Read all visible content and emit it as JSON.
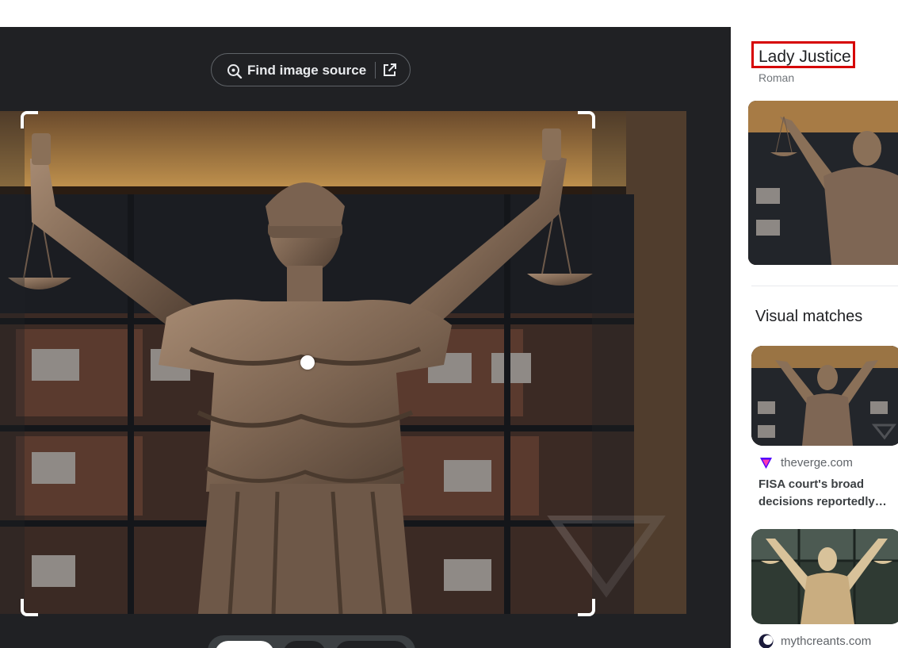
{
  "viewer": {
    "find_source_label": "Find image source",
    "find_source_icon": "lens-search-icon",
    "open_external_icon": "open-in-new-icon"
  },
  "knowledge_panel": {
    "title": "Lady Justice",
    "subtitle": "Roman"
  },
  "visual_matches": {
    "heading": "Visual matches",
    "items": [
      {
        "source": "theverge.com",
        "caption": "FISA court's broad decisions reportedly…",
        "caption_line1": "FISA court's broad",
        "caption_line2": "decisions reportedly…",
        "favicon": "theverge-favicon-icon"
      },
      {
        "source": "mythcreants.com",
        "favicon": "mythcreants-favicon-icon"
      }
    ]
  },
  "colors": {
    "viewer_bg": "#202124",
    "highlight_border": "#d60000",
    "bronze": "#8a7058"
  }
}
